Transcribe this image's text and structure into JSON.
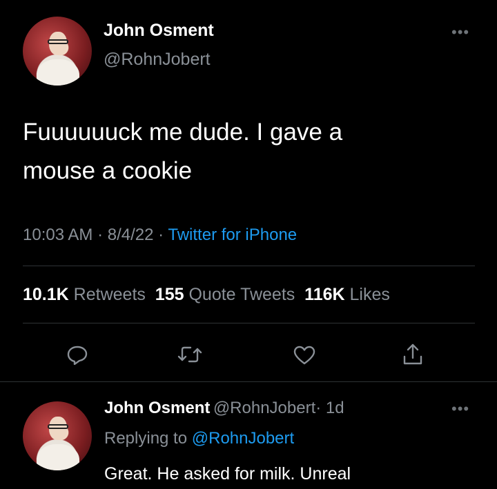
{
  "tweet": {
    "author_name": "John Osment",
    "author_handle": "@RohnJobert",
    "more_label": "•••",
    "text_line1": "Fuuuuuuck me dude. I gave a",
    "text_line2": "mouse a cookie",
    "time": "10:03 AM",
    "date": "8/4/22",
    "separator": "·",
    "source": "Twitter for iPhone",
    "stats": {
      "retweets_count": "10.1K",
      "retweets_label": "Retweets",
      "quotes_count": "155",
      "quotes_label": "Quote Tweets",
      "likes_count": "116K",
      "likes_label": "Likes"
    }
  },
  "actions": [
    {
      "icon": "reply-icon"
    },
    {
      "icon": "retweet-icon"
    },
    {
      "icon": "like-icon"
    },
    {
      "icon": "share-icon"
    }
  ],
  "reply": {
    "author_name": "John Osment",
    "author_handle": "@RohnJobert",
    "age": "· 1d",
    "more_label": "•••",
    "replying_prefix": "Replying to",
    "replying_to": "@RohnJobert",
    "text": "Great. He asked for milk. Unreal"
  },
  "colors": {
    "background": "#000000",
    "link": "#1d9bf0",
    "secondary_text": "#8a9097",
    "divider": "#2f3336"
  }
}
